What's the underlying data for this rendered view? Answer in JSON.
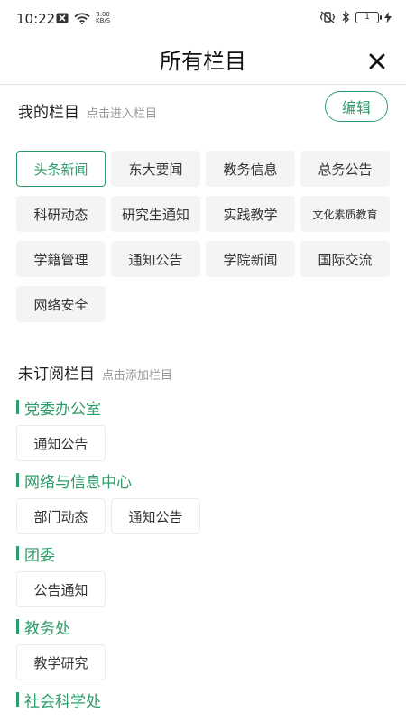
{
  "status_bar": {
    "time": "10:22",
    "speed_value": "9.00",
    "speed_unit": "KB/S",
    "battery": "1"
  },
  "header": {
    "title": "所有栏目"
  },
  "my_channels": {
    "title": "我的栏目",
    "hint": "点击进入栏目",
    "edit_label": "编辑",
    "items": [
      {
        "label": "头条新闻"
      },
      {
        "label": "东大要闻"
      },
      {
        "label": "教务信息"
      },
      {
        "label": "总务公告"
      },
      {
        "label": "科研动态"
      },
      {
        "label": "研究生通知"
      },
      {
        "label": "实践教学"
      },
      {
        "label": "文化素质教育"
      },
      {
        "label": "学籍管理"
      },
      {
        "label": "通知公告"
      },
      {
        "label": "学院新闻"
      },
      {
        "label": "国际交流"
      },
      {
        "label": "网络安全"
      }
    ]
  },
  "unsubscribed": {
    "title": "未订阅栏目",
    "hint": "点击添加栏目",
    "groups": [
      {
        "name": "党委办公室",
        "items": [
          "通知公告"
        ]
      },
      {
        "name": "网络与信息中心",
        "items": [
          "部门动态",
          "通知公告"
        ]
      },
      {
        "name": "团委",
        "items": [
          "公告通知"
        ]
      },
      {
        "name": "教务处",
        "items": [
          "教学研究"
        ]
      },
      {
        "name": "社会科学处",
        "items": []
      }
    ]
  },
  "colors": {
    "accent": "#2e9c68",
    "chip_bg": "#f4f4f4",
    "hint": "#999999"
  }
}
